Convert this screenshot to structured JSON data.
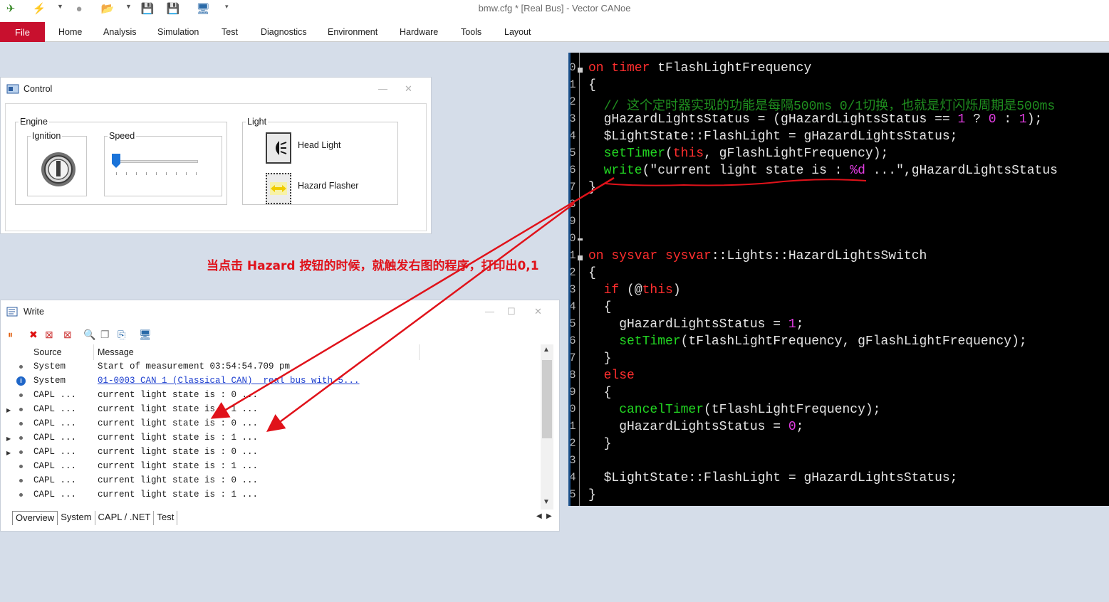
{
  "app": {
    "title": "bmw.cfg * [Real Bus] - Vector CANoe"
  },
  "ribbon": {
    "file": "File",
    "tabs": [
      "Home",
      "Analysis",
      "Simulation",
      "Test",
      "Diagnostics",
      "Environment",
      "Hardware",
      "Tools",
      "Layout"
    ]
  },
  "control_window": {
    "title": "Control",
    "engine": {
      "group": "Engine",
      "ignition": "Ignition",
      "speed": "Speed",
      "speed_level": 0
    },
    "light": {
      "group": "Light",
      "head_light": "Head Light",
      "hazard_flasher": "Hazard Flasher"
    }
  },
  "write_window": {
    "title": "Write",
    "columns": {
      "source": "Source",
      "message": "Message"
    },
    "rows": [
      {
        "source": "System",
        "message": "Start of measurement 03:54:54.709 pm",
        "type": "normal"
      },
      {
        "source": "System",
        "message": "01-0003 CAN 1 (Classical CAN)  real bus with 5...",
        "type": "info"
      },
      {
        "source": "CAPL ...",
        "message": "current light state is : 0 ...",
        "type": "normal"
      },
      {
        "source": "CAPL ...",
        "message": "current light state is : 1 ...",
        "type": "normal"
      },
      {
        "source": "CAPL ...",
        "message": "current light state is : 0 ...",
        "type": "normal"
      },
      {
        "source": "CAPL ...",
        "message": "current light state is : 1 ...",
        "type": "normal"
      },
      {
        "source": "CAPL ...",
        "message": "current light state is : 0 ...",
        "type": "normal"
      },
      {
        "source": "CAPL ...",
        "message": "current light state is : 1 ...",
        "type": "normal"
      },
      {
        "source": "CAPL ...",
        "message": "current light state is : 0 ...",
        "type": "normal"
      },
      {
        "source": "CAPL ...",
        "message": "current light state is : 1 ...",
        "type": "normal"
      }
    ],
    "tabs": [
      "Overview",
      "System",
      "CAPL / .NET",
      "Test"
    ]
  },
  "code_editor": {
    "line_numbers": [
      "0",
      "1",
      "2",
      "3",
      "4",
      "5",
      "6",
      "7",
      "8",
      "9",
      "0",
      "1",
      "2",
      "3",
      "4",
      "5",
      "6",
      "7",
      "8",
      "9",
      "0",
      "1",
      "2",
      "3",
      "4",
      "5"
    ],
    "lines": [
      [
        {
          "t": "on ",
          "c": "kw"
        },
        {
          "t": "timer ",
          "c": "kw"
        },
        {
          "t": "tFlashLightFrequency",
          "c": ""
        }
      ],
      [
        {
          "t": "{",
          "c": ""
        }
      ],
      [
        {
          "t": "  // 这个定时器实现的功能是每隔500ms 0/1切换，也就是灯闪烁周期是500ms",
          "c": "cmt"
        }
      ],
      [
        {
          "t": "  gHazardLightsStatus = (gHazardLightsStatus == ",
          "c": ""
        },
        {
          "t": "1",
          "c": "num"
        },
        {
          "t": " ? ",
          "c": ""
        },
        {
          "t": "0",
          "c": "num"
        },
        {
          "t": " : ",
          "c": ""
        },
        {
          "t": "1",
          "c": "num"
        },
        {
          "t": ");",
          "c": ""
        }
      ],
      [
        {
          "t": "  $LightState::FlashLight = gHazardLightsStatus;",
          "c": ""
        }
      ],
      [
        {
          "t": "  setTimer",
          "c": "fn"
        },
        {
          "t": "(",
          "c": ""
        },
        {
          "t": "this",
          "c": "kw"
        },
        {
          "t": ", gFlashLightFrequency);",
          "c": ""
        }
      ],
      [
        {
          "t": "  write",
          "c": "fn"
        },
        {
          "t": "(\"current light state is : ",
          "c": ""
        },
        {
          "t": "%d",
          "c": "num"
        },
        {
          "t": " ...\",gHazardLightsStatus",
          "c": ""
        }
      ],
      [
        {
          "t": "}",
          "c": ""
        }
      ],
      [],
      [],
      [],
      [
        {
          "t": "on ",
          "c": "kw"
        },
        {
          "t": "sysvar ",
          "c": "kw"
        },
        {
          "t": "sysvar",
          "c": "kw"
        },
        {
          "t": "::Lights::HazardLightsSwitch",
          "c": ""
        }
      ],
      [
        {
          "t": "{",
          "c": ""
        }
      ],
      [
        {
          "t": "  if ",
          "c": "kw"
        },
        {
          "t": "(@",
          "c": ""
        },
        {
          "t": "this",
          "c": "kw"
        },
        {
          "t": ")",
          "c": ""
        }
      ],
      [
        {
          "t": "  {",
          "c": ""
        }
      ],
      [
        {
          "t": "    gHazardLightsStatus = ",
          "c": ""
        },
        {
          "t": "1",
          "c": "num"
        },
        {
          "t": ";",
          "c": ""
        }
      ],
      [
        {
          "t": "    setTimer",
          "c": "fn"
        },
        {
          "t": "(tFlashLightFrequency, gFlashLightFrequency);",
          "c": ""
        }
      ],
      [
        {
          "t": "  }",
          "c": ""
        }
      ],
      [
        {
          "t": "  else",
          "c": "kw"
        }
      ],
      [
        {
          "t": "  {",
          "c": ""
        }
      ],
      [
        {
          "t": "    cancelTimer",
          "c": "fn"
        },
        {
          "t": "(tFlashLightFrequency);",
          "c": ""
        }
      ],
      [
        {
          "t": "    gHazardLightsStatus = ",
          "c": ""
        },
        {
          "t": "0",
          "c": "num"
        },
        {
          "t": ";",
          "c": ""
        }
      ],
      [
        {
          "t": "  }",
          "c": ""
        }
      ],
      [],
      [
        {
          "t": "  $LightState::FlashLight = gHazardLightsStatus;",
          "c": ""
        }
      ],
      [
        {
          "t": "}",
          "c": ""
        }
      ]
    ]
  },
  "annotation": {
    "text_before": "当点击 ",
    "text_bold": "Hazard",
    "text_after": " 按钮的时候，就触发右图的程序，打印出0,1",
    "color": "#e0121a"
  }
}
